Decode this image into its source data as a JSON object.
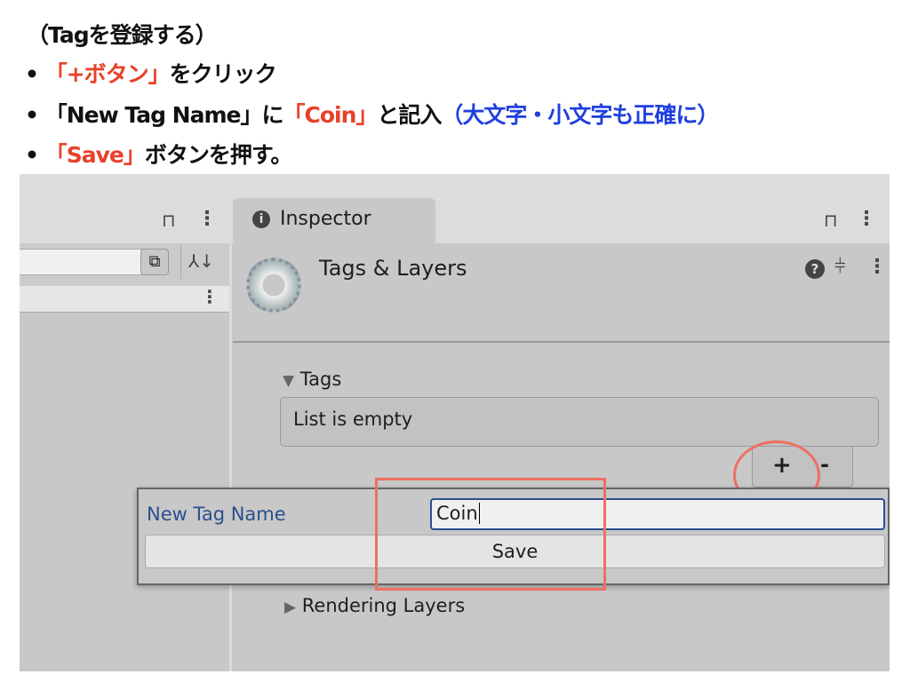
{
  "instructions": {
    "heading": "（Tagを登録する）",
    "bullet": "•",
    "step1": {
      "highlight": "「+ボタン」",
      "rest": "をクリック"
    },
    "step2": {
      "part1": "「New Tag Name」に",
      "highlight": "「Coin」",
      "part2": "と記入",
      "note": "（大文字・小文字も正確に）"
    },
    "step3": {
      "highlight": "「Save」",
      "rest": "ボタンを押す。"
    }
  },
  "inspector": {
    "tab_label": "Inspector",
    "title": "Tags & Layers",
    "tags_section": "Tags",
    "list_empty": "List is empty",
    "add_button": "+",
    "remove_button": "-",
    "rendering_layers": "Rendering Layers"
  },
  "popup": {
    "label": "New Tag Name",
    "input_value": "Coin",
    "save_button": "Save"
  },
  "colors": {
    "highlight_red": "#e8412a",
    "note_blue": "#1f3fe0",
    "annotation": "#ef7060",
    "label_blue": "#2a4f8f"
  }
}
